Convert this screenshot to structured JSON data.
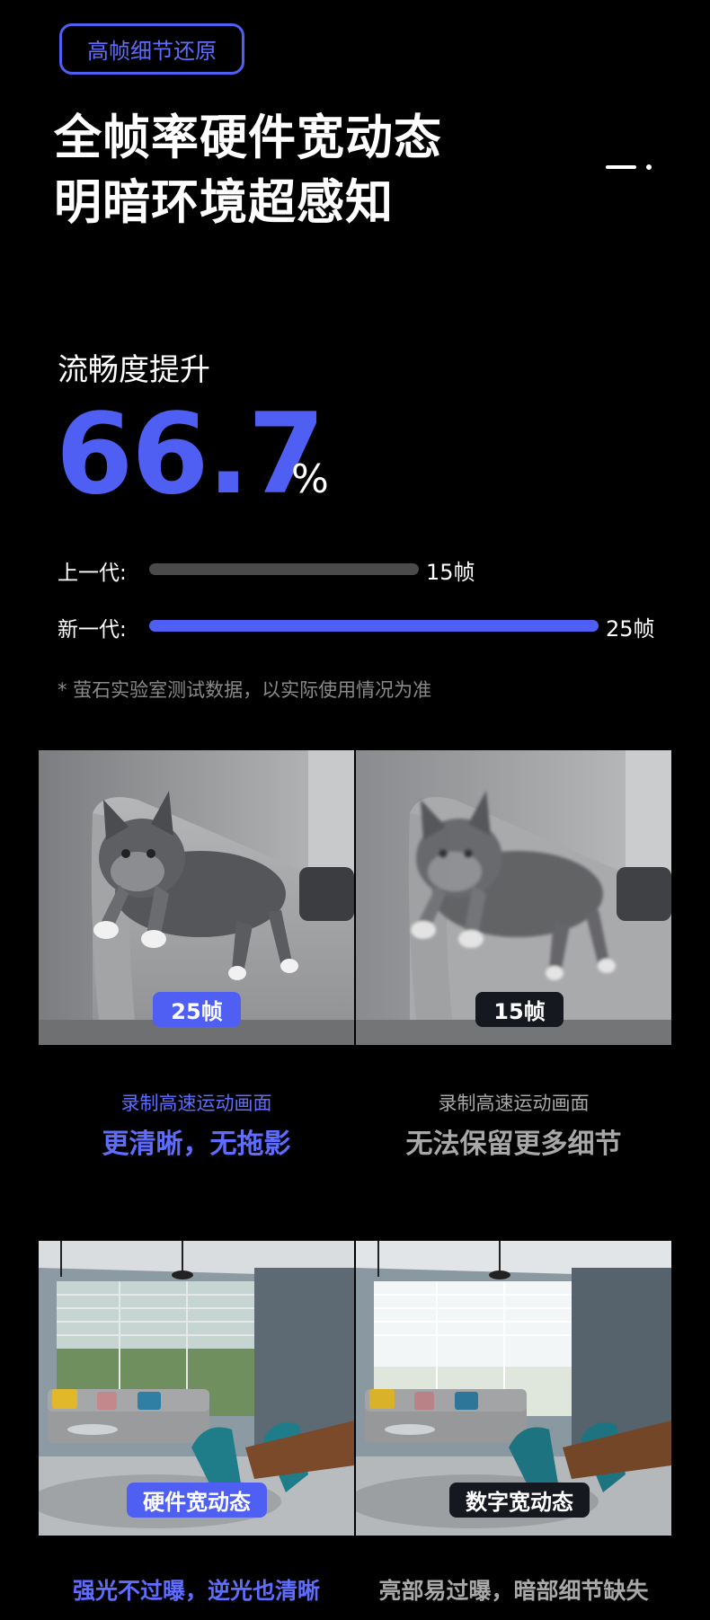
{
  "tag": "高帧细节还原",
  "headline": {
    "line1": "全帧率硬件宽动态",
    "line2": "明暗环境超感知"
  },
  "metric": {
    "label": "流畅度提升",
    "value": "66.7",
    "unit": "%"
  },
  "comparison": [
    {
      "label": "上一代:",
      "value": "15帧",
      "fill": 0.6,
      "color": "#4a4a4a"
    },
    {
      "label": "新一代:",
      "value": "25帧",
      "fill": 1.0,
      "color": "#4f5ff4"
    }
  ],
  "note": "* 萤石实验室测试数据，以实际使用情况为准",
  "motion": {
    "left": {
      "badge": "25帧",
      "caption_small": "录制高速运动画面",
      "caption_big": "更清晰，无拖影"
    },
    "right": {
      "badge": "15帧",
      "caption_small": "录制高速运动画面",
      "caption_big": "无法保留更多细节"
    }
  },
  "wdr": {
    "left": {
      "badge": "硬件宽动态",
      "caption_big": "强光不过曝，逆光也清晰"
    },
    "right": {
      "badge": "数字宽动态",
      "caption_big": "亮部易过曝，暗部细节缺失"
    }
  },
  "colors": {
    "accent": "#4f5ff4",
    "background": "#000000"
  }
}
